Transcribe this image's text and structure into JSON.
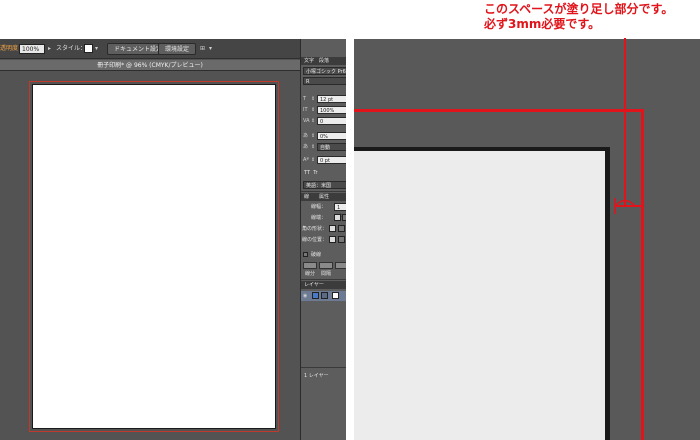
{
  "editor": {
    "toolbar": {
      "opacity_label": "透明度：",
      "opacity_value": "100%",
      "style_label": "スタイル：",
      "doc_settings_label": "ドキュメント設定",
      "env_settings_label": "環境設定"
    },
    "document_tab": {
      "title": "冊子印刷* @ 96% (CMYK/プレビュー)"
    },
    "panel": {
      "character_tab": "文字",
      "paragraph_tab": "段落",
      "font_name": "小塚ゴシック Pr6",
      "font_style": "R",
      "font_size": "12 pt",
      "vertical_scale": "100%",
      "tracking": "0",
      "tsume": "0%",
      "aki": "自動",
      "baseline_shift": "0 pt",
      "language": "英語：米国",
      "stroke_tab": "線",
      "attributes_tab": "属性",
      "weight_label": "線幅：",
      "weight_value": "1 pt",
      "cap_label": "線端：",
      "corner_label": "角の形状：",
      "align_label": "線の位置：",
      "dashed_label": "破線",
      "dash_label": "線分",
      "gap_label": "間隔",
      "layers_tab": "レイヤー",
      "layer_count": "1 レイヤー"
    }
  },
  "annotation": {
    "line1": "このスペースが塗り足し部分です。",
    "line2": "必ず3mm必要です。"
  },
  "colors": {
    "accent_red": "#e0141a",
    "canvas_gray": "#535353",
    "page_white": "#ffffff"
  }
}
